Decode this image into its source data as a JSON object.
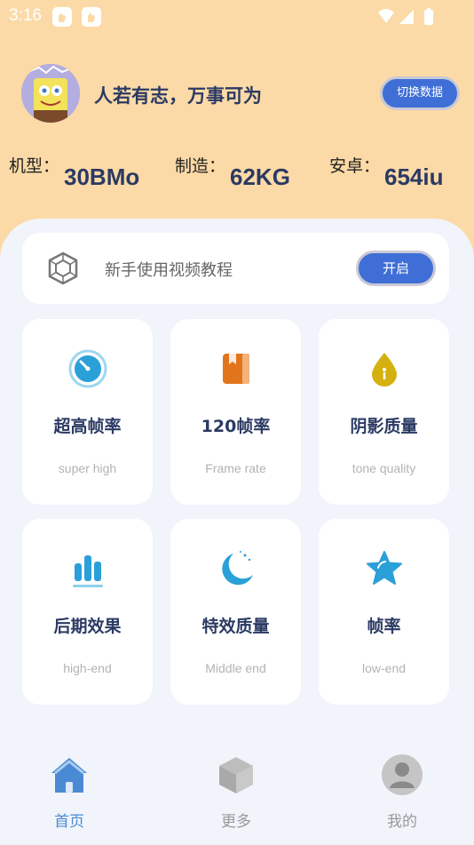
{
  "status": {
    "time": "3:16"
  },
  "header": {
    "motto": "人若有志，万事可为",
    "switch_label": "切换数据"
  },
  "specs": [
    {
      "label": "机型：",
      "value": "30BMo"
    },
    {
      "label": "制造：",
      "value": "62KG"
    },
    {
      "label": "安卓：",
      "value": "654iu"
    }
  ],
  "tutorial": {
    "text": "新手使用视频教程",
    "button": "开启"
  },
  "features": [
    {
      "title": "超高帧率",
      "subtitle": "super high",
      "icon": "speedometer-icon",
      "color": "#2aa0d8"
    },
    {
      "title": "120帧率",
      "subtitle": "Frame rate",
      "icon": "book-icon",
      "color": "#e2751c"
    },
    {
      "title": "阴影质量",
      "subtitle": "tone quality",
      "icon": "drop-icon",
      "color": "#d4b10e"
    },
    {
      "title": "后期效果",
      "subtitle": "high-end",
      "icon": "bar-chart-icon",
      "color": "#2aa0d8"
    },
    {
      "title": "特效质量",
      "subtitle": "Middle end",
      "icon": "moon-icon",
      "color": "#2aa0d8"
    },
    {
      "title": "帧率",
      "subtitle": "low-end",
      "icon": "star-icon",
      "color": "#2aa0d8"
    }
  ],
  "nav": [
    {
      "label": "首页",
      "icon": "home-icon",
      "active": true
    },
    {
      "label": "更多",
      "icon": "cube-icon",
      "active": false
    },
    {
      "label": "我的",
      "icon": "user-icon",
      "active": false
    }
  ]
}
